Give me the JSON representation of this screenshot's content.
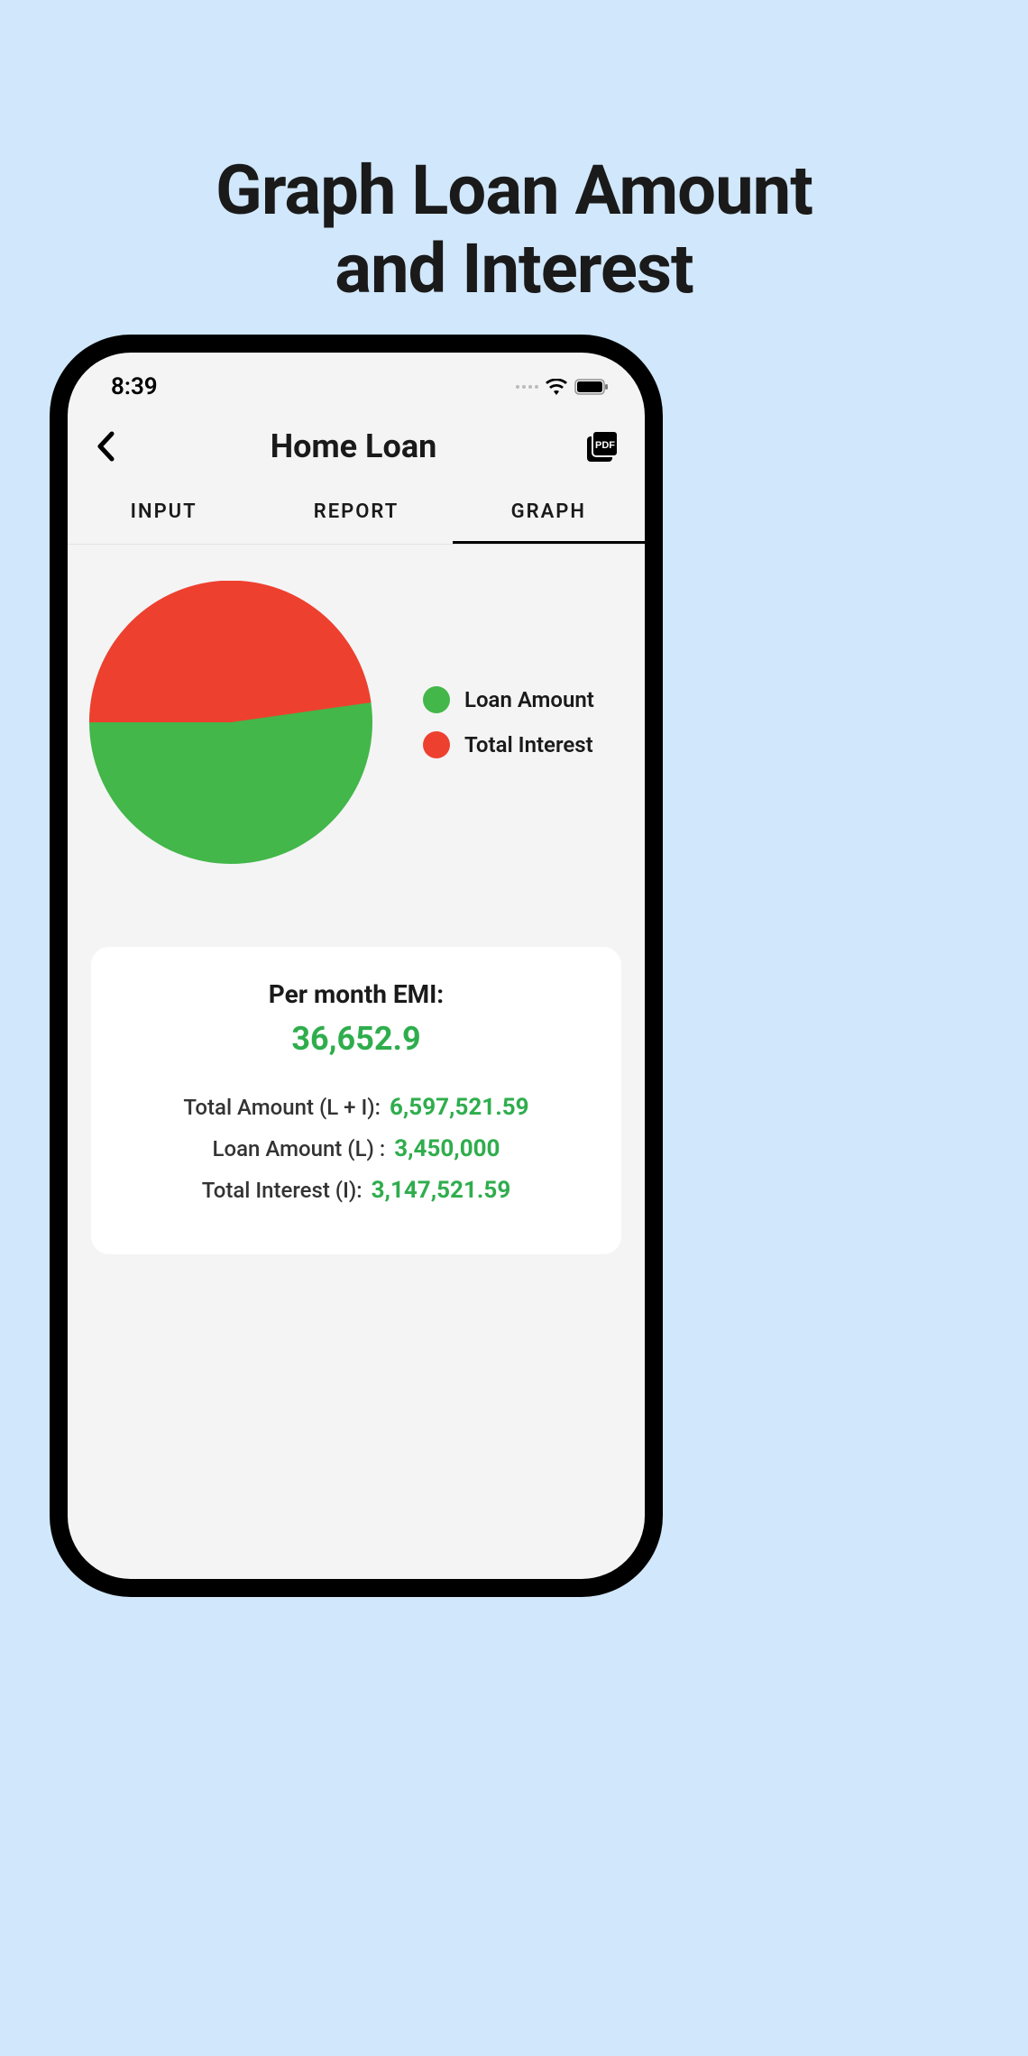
{
  "promo": {
    "title_line1": "Graph Loan Amount",
    "title_line2": "and Interest"
  },
  "status": {
    "time": "8:39"
  },
  "nav": {
    "title": "Home Loan"
  },
  "tabs": {
    "input": "INPUT",
    "report": "REPORT",
    "graph": "GRAPH",
    "active": "graph"
  },
  "legend": {
    "loan_amount": "Loan Amount",
    "total_interest": "Total Interest"
  },
  "colors": {
    "loan_amount": "#43b749",
    "total_interest": "#ee402f"
  },
  "summary": {
    "emi_label": "Per month EMI:",
    "emi_value": "36,652.9",
    "total_amount_label": "Total Amount (L + I):",
    "total_amount_value": "6,597,521.59",
    "loan_amount_label": "Loan Amount (L) :",
    "loan_amount_value": "3,450,000",
    "total_interest_label": "Total Interest (I):",
    "total_interest_value": "3,147,521.59"
  },
  "chart_data": {
    "type": "pie",
    "categories": [
      "Loan Amount",
      "Total Interest"
    ],
    "values": [
      3450000,
      3147521.59
    ],
    "series": [
      {
        "name": "Loan Amount",
        "value": 3450000,
        "percent": 52.3,
        "color": "#43b749"
      },
      {
        "name": "Total Interest",
        "value": 3147521.59,
        "percent": 47.7,
        "color": "#ee402f"
      }
    ],
    "title": "",
    "legend_position": "right"
  }
}
